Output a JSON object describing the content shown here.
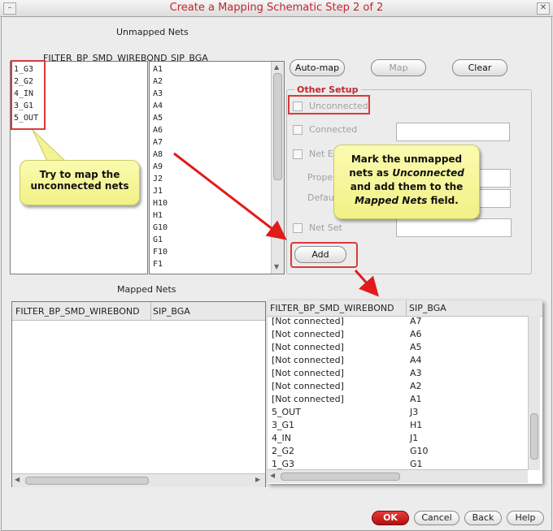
{
  "window": {
    "title": "Create a Mapping Schematic Step 2 of 2",
    "min_glyph": "–",
    "close_glyph": "✕"
  },
  "unmapped": {
    "label": "Unmapped Nets",
    "left_header": "FILTER_BP_SMD_WIREBOND",
    "right_header": "SIP_BGA",
    "left_pins": [
      "1_G3",
      "2_G2",
      "4_IN",
      "3_G1",
      "5_OUT"
    ],
    "right_pins": [
      "A1",
      "A2",
      "A3",
      "A4",
      "A5",
      "A6",
      "A7",
      "A8",
      "A9",
      "J2",
      "J1",
      "H10",
      "H1",
      "G10",
      "G1",
      "F10",
      "F1"
    ]
  },
  "toolbar": {
    "automap": "Auto-map",
    "map": "Map",
    "clear": "Clear"
  },
  "other_setup": {
    "title": "Other Setup",
    "unconnected": "Unconnected",
    "connected": "Connected",
    "net_ex": "Net Ex",
    "prope": "Prope",
    "defau": "Defau",
    "net_set": "Net Set"
  },
  "add_button": "Add",
  "callouts": {
    "left": "Try to map the unconnected nets",
    "right_1": "Mark the unmapped nets as ",
    "right_em1": "Unconnected",
    "right_2": " and add them to the ",
    "right_em2": "Mapped Nets",
    "right_3": " field."
  },
  "mapped": {
    "label": "Mapped Nets",
    "col1": "FILTER_BP_SMD_WIREBOND",
    "col2": "SIP_BGA",
    "rows": [
      [
        "[Not connected]",
        "A7"
      ],
      [
        "[Not connected]",
        "A6"
      ],
      [
        "[Not connected]",
        "A5"
      ],
      [
        "[Not connected]",
        "A4"
      ],
      [
        "[Not connected]",
        "A3"
      ],
      [
        "[Not connected]",
        "A2"
      ],
      [
        "[Not connected]",
        "A1"
      ],
      [
        "5_OUT",
        "J3"
      ],
      [
        "3_G1",
        "H1"
      ],
      [
        "4_IN",
        "J1"
      ],
      [
        "2_G2",
        "G10"
      ],
      [
        "1_G3",
        "G1"
      ]
    ]
  },
  "footer": {
    "ok": "OK",
    "cancel": "Cancel",
    "back": "Back",
    "help": "Help"
  },
  "colors": {
    "accent_red": "#d93a3a",
    "title_red": "#c1272d",
    "callout_yellow": "#f6f69a"
  }
}
